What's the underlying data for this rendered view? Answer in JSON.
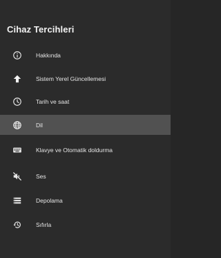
{
  "header": {
    "title": "Cihaz Tercihleri"
  },
  "menu": {
    "items": [
      {
        "label": "Hakkında",
        "icon": "info-icon"
      },
      {
        "label": "Sistem Yerel Güncellemesi",
        "icon": "arrow-up-icon"
      },
      {
        "label": "Tarih ve saat",
        "icon": "clock-icon"
      },
      {
        "label": "Dil",
        "icon": "globe-icon",
        "selected": true
      },
      {
        "label": "Klavye ve Otomatik doldurma",
        "icon": "keyboard-icon"
      },
      {
        "label": "Ses",
        "icon": "sound-off-icon"
      },
      {
        "label": "Depolama",
        "icon": "storage-icon"
      },
      {
        "label": "Sıfırla",
        "icon": "reset-history-icon"
      }
    ]
  },
  "colors": {
    "background": "#2b2b2b",
    "selected_row": "#515151",
    "text": "#e6e6e6"
  }
}
